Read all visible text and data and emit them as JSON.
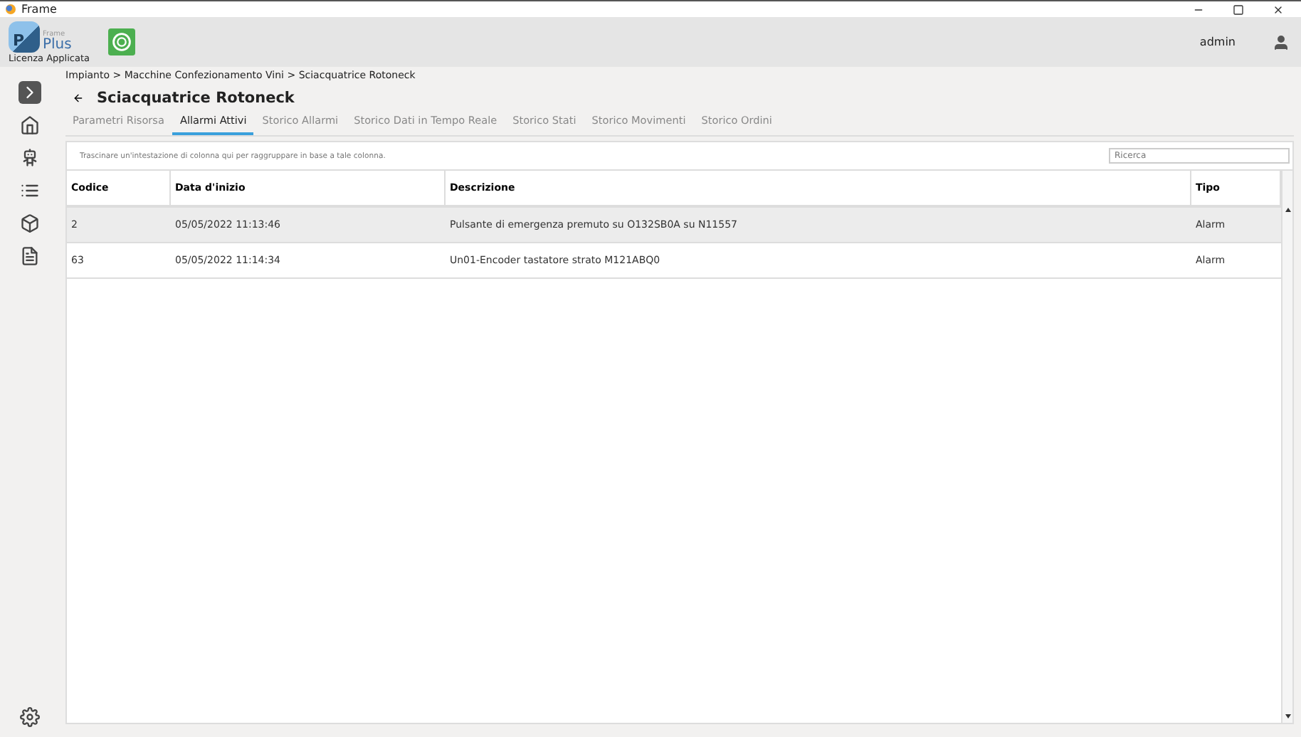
{
  "window": {
    "title": "Frame"
  },
  "header": {
    "logo_small": "Frame",
    "logo_big": "Plus",
    "logo_letter": "P",
    "license": "Licenza Applicata",
    "user": "admin"
  },
  "breadcrumb": "Impianto > Macchine Confezionamento Vini > Sciacquatrice Rotoneck",
  "page_title": "Sciacquatrice Rotoneck",
  "tabs": [
    {
      "label": "Parametri Risorsa",
      "selected": false
    },
    {
      "label": "Allarmi Attivi",
      "selected": true
    },
    {
      "label": "Storico Allarmi",
      "selected": false
    },
    {
      "label": "Storico Dati in Tempo Reale",
      "selected": false
    },
    {
      "label": "Storico Stati",
      "selected": false
    },
    {
      "label": "Storico Movimenti",
      "selected": false
    },
    {
      "label": "Storico Ordini",
      "selected": false
    }
  ],
  "grid": {
    "group_hint": "Trascinare un'intestazione di colonna qui per raggruppare in base a tale colonna.",
    "search": {
      "placeholder": "Ricerca"
    },
    "columns": [
      "Codice",
      "Data d'inizio",
      "Descrizione",
      "Tipo"
    ],
    "rows": [
      {
        "cells": [
          "2",
          "05/05/2022 11:13:46",
          "Pulsante di emergenza premuto su O132SB0A su N11557",
          "Alarm"
        ],
        "selected": true
      },
      {
        "cells": [
          "63",
          "05/05/2022 11:14:34",
          "Un01-Encoder tastatore strato M121ABQ0",
          "Alarm"
        ],
        "selected": false
      }
    ]
  }
}
